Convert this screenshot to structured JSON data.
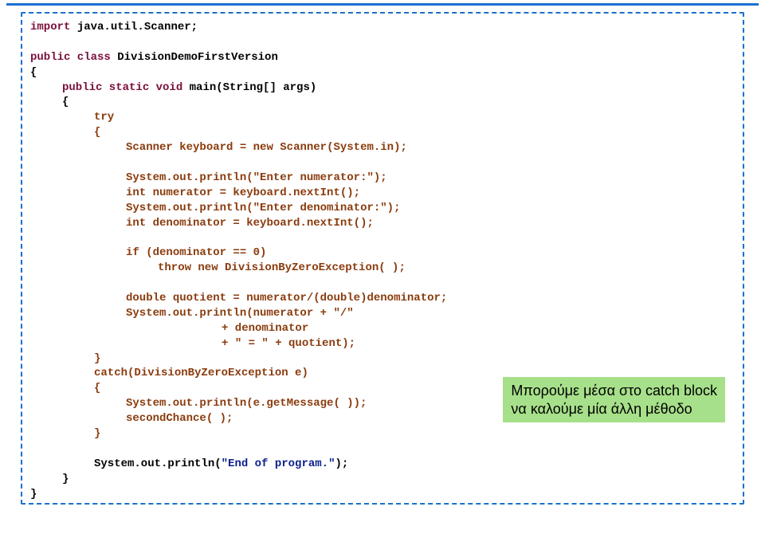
{
  "code": {
    "l1a": "import",
    "l1b": " java.util.Scanner;",
    "l2a": "public class",
    "l2b": " DivisionDemoFirstVersion",
    "l3": "{",
    "l4a": "public static void",
    "l4b": " main(String[] args)",
    "l5": "{",
    "l6a": "try",
    "l7": "{",
    "l8a": "Scanner keyboard = ",
    "l8b": "new",
    "l8c": " Scanner(System.in);",
    "l9a": "System.out.println(",
    "l9b": "\"Enter numerator:\"",
    "l9c": ");",
    "l10a": "int",
    "l10b": " numerator = keyboard.nextInt();",
    "l11a": "System.out.println(",
    "l11b": "\"Enter denominator:\"",
    "l11c": ");",
    "l12a": "int",
    "l12b": " denominator = keyboard.nextInt();",
    "l13a": "if",
    "l13b": " (denominator == 0)",
    "l14a": "throw new",
    "l14b": " DivisionByZeroException( );",
    "l15a": "double",
    "l15b": " quotient = numerator/(",
    "l15c": "double",
    "l15d": ")denominator;",
    "l16a": "System.out.println(numerator + ",
    "l16b": "\"/\"",
    "l17a": "+ denominator",
    "l18a": "+ ",
    "l18b": "\" = \"",
    "l18c": " + quotient);",
    "l19": "}",
    "l20a": "catch",
    "l20b": "(DivisionByZeroException e)",
    "l21": "{",
    "l22": "System.out.println(e.getMessage( ));",
    "l23": "secondChance( );",
    "l24": "}",
    "l25a": "System.out.println(",
    "l25b": "\"End of program.\"",
    "l25c": ");",
    "l26": "}",
    "l27": "}"
  },
  "callout": {
    "line1": "Μπορούμε μέσα στο catch block",
    "line2": "να καλούμε μία άλλη μέθοδο"
  }
}
